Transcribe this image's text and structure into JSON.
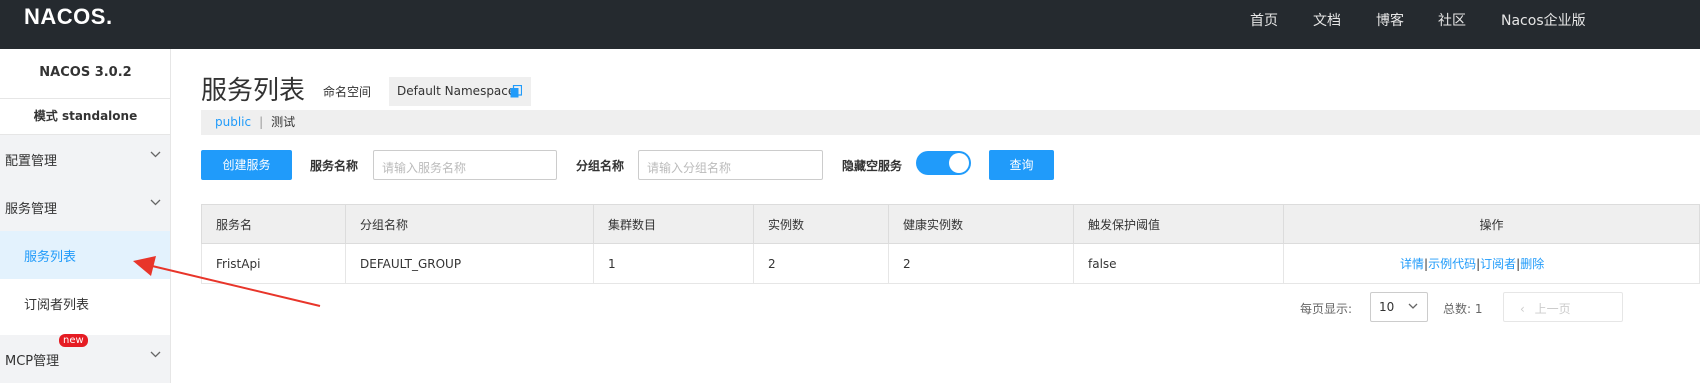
{
  "header": {
    "logo": "NACOS.",
    "nav": [
      "首页",
      "文档",
      "博客",
      "社区",
      "Nacos企业版"
    ]
  },
  "sidebar": {
    "version": "NACOS 3.0.2",
    "mode": "模式 standalone",
    "groups": [
      {
        "label": "配置管理"
      },
      {
        "label": "服务管理"
      },
      {
        "label": "MCP管理",
        "badge": "new"
      }
    ],
    "items": [
      {
        "label": "服务列表",
        "active": true
      },
      {
        "label": "订阅者列表"
      }
    ]
  },
  "page": {
    "title": "服务列表",
    "namespace_label": "命名空间",
    "namespace_value": "Default Namespace",
    "namespaces": [
      "public",
      "测试"
    ]
  },
  "filters": {
    "create_button": "创建服务",
    "service_name_label": "服务名称",
    "service_name_placeholder": "请输入服务名称",
    "group_name_label": "分组名称",
    "group_name_placeholder": "请输入分组名称",
    "hide_empty_label": "隐藏空服务",
    "hide_empty_on": true,
    "query_button": "查询"
  },
  "table": {
    "headers": [
      "服务名",
      "分组名称",
      "集群数目",
      "实例数",
      "健康实例数",
      "触发保护阈值",
      "操作"
    ],
    "rows": [
      {
        "service": "FristApi",
        "group": "DEFAULT_GROUP",
        "clusters": "1",
        "instances": "2",
        "healthy": "2",
        "threshold": "false",
        "actions": [
          "详情",
          "示例代码",
          "订阅者",
          "删除"
        ]
      }
    ]
  },
  "pagination": {
    "page_size_label": "每页显示:",
    "page_size": "10",
    "total_label": "总数: 1",
    "prev_label": "上一页"
  },
  "colors": {
    "accent": "#209bfa",
    "topbar": "#252a2f",
    "annotation_arrow": "#e8352a"
  }
}
